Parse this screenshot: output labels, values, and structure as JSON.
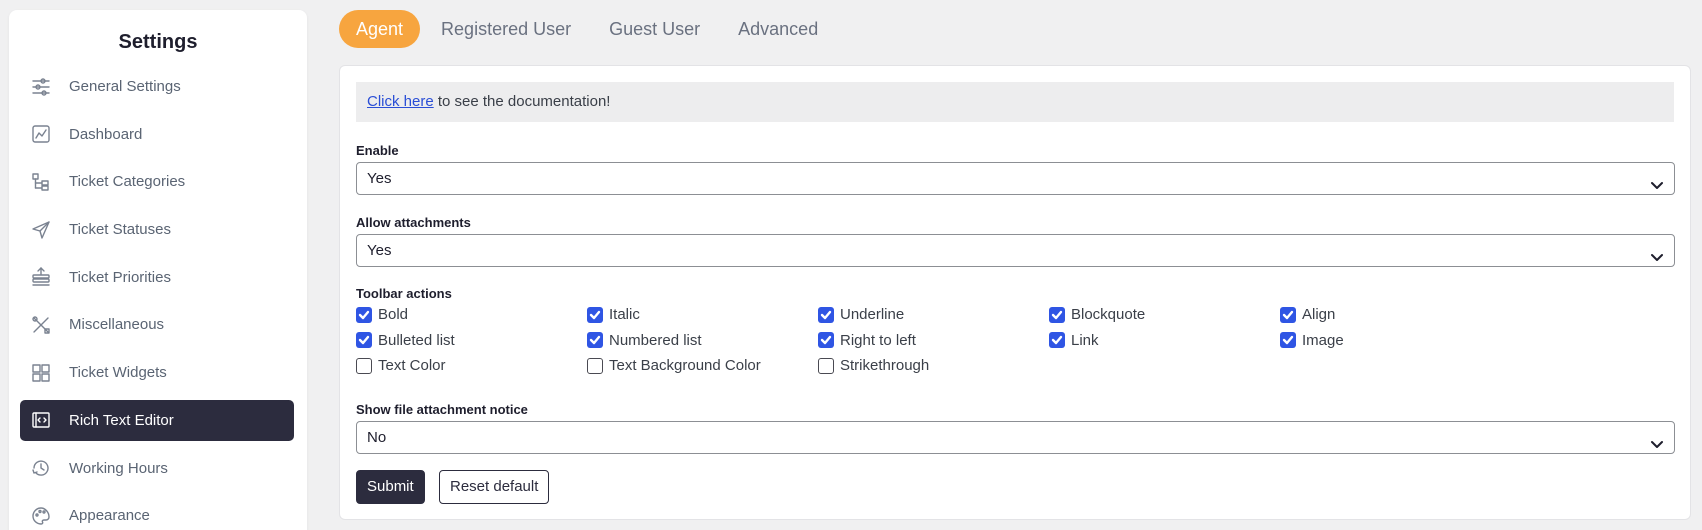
{
  "sidebar": {
    "title": "Settings",
    "items": [
      {
        "label": "General Settings",
        "icon": "sliders-icon"
      },
      {
        "label": "Dashboard",
        "icon": "dashboard-chart-icon"
      },
      {
        "label": "Ticket Categories",
        "icon": "category-tree-icon"
      },
      {
        "label": "Ticket Statuses",
        "icon": "send-arrow-icon"
      },
      {
        "label": "Ticket Priorities",
        "icon": "priority-stack-icon"
      },
      {
        "label": "Miscellaneous",
        "icon": "tools-icon"
      },
      {
        "label": "Ticket Widgets",
        "icon": "widgets-grid-icon"
      },
      {
        "label": "Rich Text Editor",
        "icon": "code-window-icon",
        "active": true
      },
      {
        "label": "Working Hours",
        "icon": "clock-history-icon"
      },
      {
        "label": "Appearance",
        "icon": "palette-icon"
      }
    ]
  },
  "tabs": [
    "Agent",
    "Registered User",
    "Guest User",
    "Advanced"
  ],
  "active_tab": "Agent",
  "doc_banner": {
    "link_text": "Click here",
    "text": " to see the documentation!"
  },
  "fields": {
    "enable": {
      "label": "Enable",
      "value": "Yes"
    },
    "allow_attachments": {
      "label": "Allow attachments",
      "value": "Yes"
    },
    "toolbar_actions": {
      "label": "Toolbar actions"
    },
    "show_file_notice": {
      "label": "Show file attachment notice",
      "value": "No"
    }
  },
  "toolbar_options": [
    [
      {
        "label": "Bold",
        "checked": true
      },
      {
        "label": "Italic",
        "checked": true
      },
      {
        "label": "Underline",
        "checked": true
      },
      {
        "label": "Blockquote",
        "checked": true
      },
      {
        "label": "Align",
        "checked": true
      }
    ],
    [
      {
        "label": "Bulleted list",
        "checked": true
      },
      {
        "label": "Numbered list",
        "checked": true
      },
      {
        "label": "Right to left",
        "checked": true
      },
      {
        "label": "Link",
        "checked": true
      },
      {
        "label": "Image",
        "checked": true
      }
    ],
    [
      {
        "label": "Text Color",
        "checked": false
      },
      {
        "label": "Text Background Color",
        "checked": false
      },
      {
        "label": "Strikethrough",
        "checked": false
      }
    ]
  ],
  "buttons": {
    "submit": "Submit",
    "reset": "Reset default"
  },
  "colors": {
    "accent_tab": "#f7a53f",
    "active_sidebar": "#2c2c3e",
    "checkbox_on": "#2f55e4",
    "link": "#2a4ed6"
  }
}
